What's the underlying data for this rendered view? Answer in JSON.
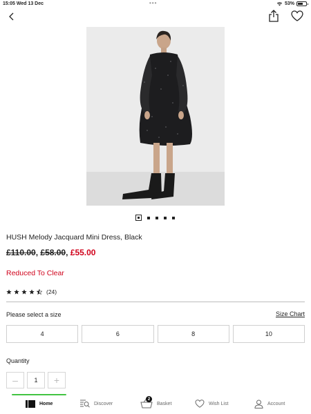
{
  "status_bar": {
    "time": "15:05",
    "date": "Wed 13 Dec",
    "battery": "53%"
  },
  "header": {
    "back_icon": "chevron-left-icon",
    "share_icon": "share-icon",
    "wishlist_icon": "heart-icon"
  },
  "gallery": {
    "total_images": 5,
    "active_index": 0
  },
  "product": {
    "title": "HUSH Melody Jacquard Mini Dress, Black",
    "price_was": "£110.00",
    "price_was2": "£58.00",
    "price_sep": ", ",
    "price_sep2": ", ",
    "price_now": "£55.00",
    "promo": "Reduced To Clear",
    "rating_stars": 4.5,
    "review_count": "(24)"
  },
  "size": {
    "prompt": "Please select a size",
    "chart_link": "Size Chart",
    "options": [
      "4",
      "6",
      "8",
      "10"
    ]
  },
  "quantity": {
    "label": "Quantity",
    "value": "1",
    "minus": "–",
    "plus": "+"
  },
  "tabs": [
    {
      "label": "Home",
      "icon": "home-icon",
      "active": true
    },
    {
      "label": "Discover",
      "icon": "discover-icon",
      "active": false
    },
    {
      "label": "Basket",
      "icon": "basket-icon",
      "active": false,
      "badge": "2"
    },
    {
      "label": "Wish List",
      "icon": "heart-icon",
      "active": false
    },
    {
      "label": "Account",
      "icon": "account-icon",
      "active": false
    }
  ],
  "colors": {
    "accent_red": "#d0021b",
    "tab_indicator": "#41c441"
  }
}
